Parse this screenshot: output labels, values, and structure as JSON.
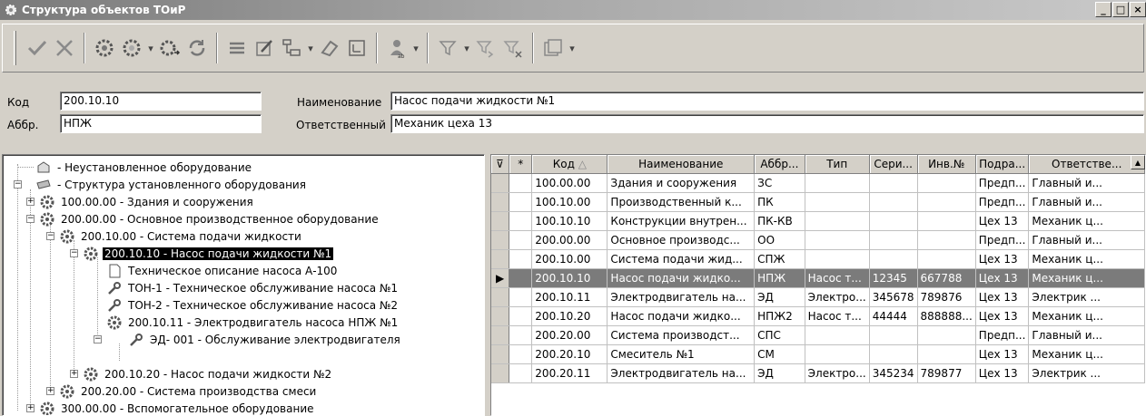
{
  "window": {
    "title": "Структура объектов ТОиР",
    "buttons": [
      "_",
      "□",
      "×"
    ]
  },
  "toolbar": {
    "buttons": [
      "check-icon",
      "cross-icon",
      "gear-add-icon",
      "gear-edit-icon",
      "gear-move-icon",
      "refresh-icon",
      "list-icon",
      "edit-icon",
      "structure-icon",
      "eraser-icon",
      "card-icon",
      "users-icon",
      "filter-icon",
      "filter-next-icon",
      "filter-clear-icon",
      "window-icon"
    ]
  },
  "form": {
    "code_label": "Код",
    "code_value": "200.10.10",
    "abbr_label": "Аббр.",
    "abbr_value": "НПЖ",
    "name_label": "Наименование",
    "name_value": "Насос подачи жидкости №1",
    "resp_label": "Ответственный",
    "resp_value": "Механик цеха 13"
  },
  "tree": [
    {
      "text": "- Неустановленное оборудование",
      "icon": "box-icon"
    },
    {
      "text": "- Структура установленного оборудования",
      "icon": "structure-icon"
    },
    {
      "text": "100.00.00 - Здания и сооружения",
      "icon": "gear-icon"
    },
    {
      "text": "200.00.00 - Основное производственное оборудование",
      "icon": "gear-icon"
    },
    {
      "text": "200.10.00 - Система подачи жидкости",
      "icon": "gear-icon"
    },
    {
      "text": "200.10.10 - Насос подачи жидкости №1",
      "icon": "gear-icon"
    },
    {
      "text": "Техническое описание насоса А-100",
      "icon": "document-icon"
    },
    {
      "text": "ТОН-1 - Техническое обслуживание насоса №1",
      "icon": "wrench-icon"
    },
    {
      "text": "ТОН-2 - Техническое обслуживание насоса №2",
      "icon": "wrench-icon"
    },
    {
      "text": "200.10.11 - Электродвигатель насоса НПЖ №1",
      "icon": "gear-icon"
    },
    {
      "text": "ЭД- 001 - Обслуживание электродвигателя",
      "icon": "wrench-icon"
    },
    {
      "text": "200.10.20 - Насос подачи жидкости №2",
      "icon": "gear-icon"
    },
    {
      "text": "200.20.00 - Система производства смеси",
      "icon": "gear-icon"
    },
    {
      "text": "300.00.00 - Вспомогательное оборудование",
      "icon": "gear-icon"
    }
  ],
  "grid": {
    "headers": [
      "Код",
      "Наименование",
      "Аббр...",
      "Тип",
      "Сери...",
      "Инв.№",
      "Подра...",
      "Ответстве..."
    ],
    "header_marks": [
      "⊽",
      "*"
    ],
    "rows": [
      [
        "100.00.00",
        "Здания и сооружения",
        "ЗС",
        "",
        "",
        "",
        "Предп...",
        "Главный и..."
      ],
      [
        "100.10.00",
        "Производственный к...",
        "ПК",
        "",
        "",
        "",
        "Предп...",
        "Главный и..."
      ],
      [
        "100.10.10",
        "Конструкции внутрен...",
        "ПК-КВ",
        "",
        "",
        "",
        "Цех 13",
        "Механик ц..."
      ],
      [
        "200.00.00",
        "Основное производс...",
        "ОО",
        "",
        "",
        "",
        "Предп...",
        "Главный и..."
      ],
      [
        "200.10.00",
        "Система подачи жид...",
        "СПЖ",
        "",
        "",
        "",
        "Цех 13",
        "Механик ц..."
      ],
      [
        "200.10.10",
        "Насос подачи жидко...",
        "НПЖ",
        "Насос т...",
        "12345",
        "667788",
        "Цех 13",
        "Механик ц..."
      ],
      [
        "200.10.11",
        "Электродвигатель на...",
        "ЭД",
        "Электро...",
        "345678",
        "789876",
        "Цех 13",
        "Электрик ..."
      ],
      [
        "200.10.20",
        "Насос подачи жидко...",
        "НПЖ2",
        "Насос т...",
        "44444",
        "888888...",
        "Цех 13",
        "Механик ц..."
      ],
      [
        "200.20.00",
        "Система производст...",
        "СПС",
        "",
        "",
        "",
        "Предп...",
        "Главный и..."
      ],
      [
        "200.20.10",
        "Смеситель №1",
        "СМ",
        "",
        "",
        "",
        "Цех 13",
        "Механик ц..."
      ],
      [
        "200.20.11",
        "Электродвигатель на...",
        "ЭД",
        "Электро...",
        "345234",
        "789877",
        "Цех 13",
        "Электрик ..."
      ]
    ],
    "selected_row_indicator": "▶"
  }
}
